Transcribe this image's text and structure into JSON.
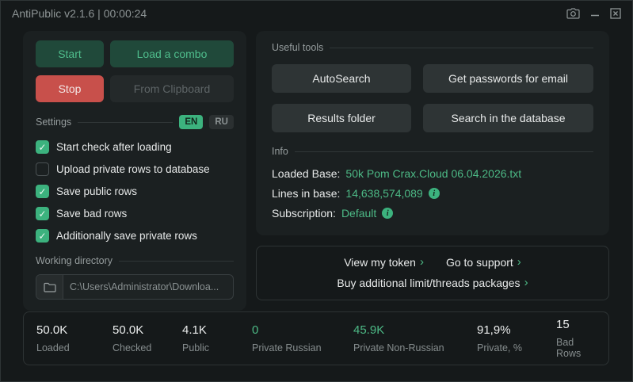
{
  "window": {
    "title": "AntiPublic v2.1.6 | 00:00:24"
  },
  "left": {
    "buttons": {
      "start": "Start",
      "load_combo": "Load a combo",
      "stop": "Stop",
      "from_clipboard": "From Clipboard"
    },
    "settings": {
      "label": "Settings",
      "languages": {
        "en": "EN",
        "ru": "RU",
        "active": "EN"
      },
      "checkboxes": [
        {
          "label": "Start check after loading",
          "checked": true
        },
        {
          "label": "Upload private rows to database",
          "checked": false
        },
        {
          "label": "Save public rows",
          "checked": true
        },
        {
          "label": "Save bad rows",
          "checked": true
        },
        {
          "label": "Additionally save private rows",
          "checked": true
        }
      ]
    },
    "working_directory": {
      "label": "Working directory",
      "path": "C:\\Users\\Administrator\\Downloa..."
    }
  },
  "right": {
    "useful_tools": {
      "label": "Useful tools",
      "buttons": [
        "AutoSearch",
        "Get passwords for email",
        "Results folder",
        "Search in the database"
      ]
    },
    "info": {
      "label": "Info",
      "rows": [
        {
          "label": "Loaded Base:",
          "value": "50k Pom Crax.Cloud 06.04.2026.txt",
          "has_info_icon": false
        },
        {
          "label": "Lines in base:",
          "value": "14,638,574,089",
          "has_info_icon": true
        },
        {
          "label": "Subscription:",
          "value": "Default",
          "has_info_icon": true
        }
      ]
    },
    "links": {
      "chevron": "›",
      "items": [
        "View my token",
        "Go to support",
        "Buy additional limit/threads packages"
      ]
    }
  },
  "stats": [
    {
      "value": "50.0K",
      "label": "Loaded",
      "green": false
    },
    {
      "value": "50.0K",
      "label": "Checked",
      "green": false
    },
    {
      "value": "4.1K",
      "label": "Public",
      "green": false
    },
    {
      "value": "0",
      "label": "Private Russian",
      "green": true
    },
    {
      "value": "45.9K",
      "label": "Private Non-Russian",
      "green": true
    },
    {
      "value": "91,9%",
      "label": "Private, %",
      "green": false
    },
    {
      "value": "15",
      "label": "Bad Rows",
      "green": false
    }
  ],
  "colors": {
    "accent_green": "#4dba86",
    "toggle_green": "#3cb27e",
    "danger_red": "#c8504b"
  }
}
